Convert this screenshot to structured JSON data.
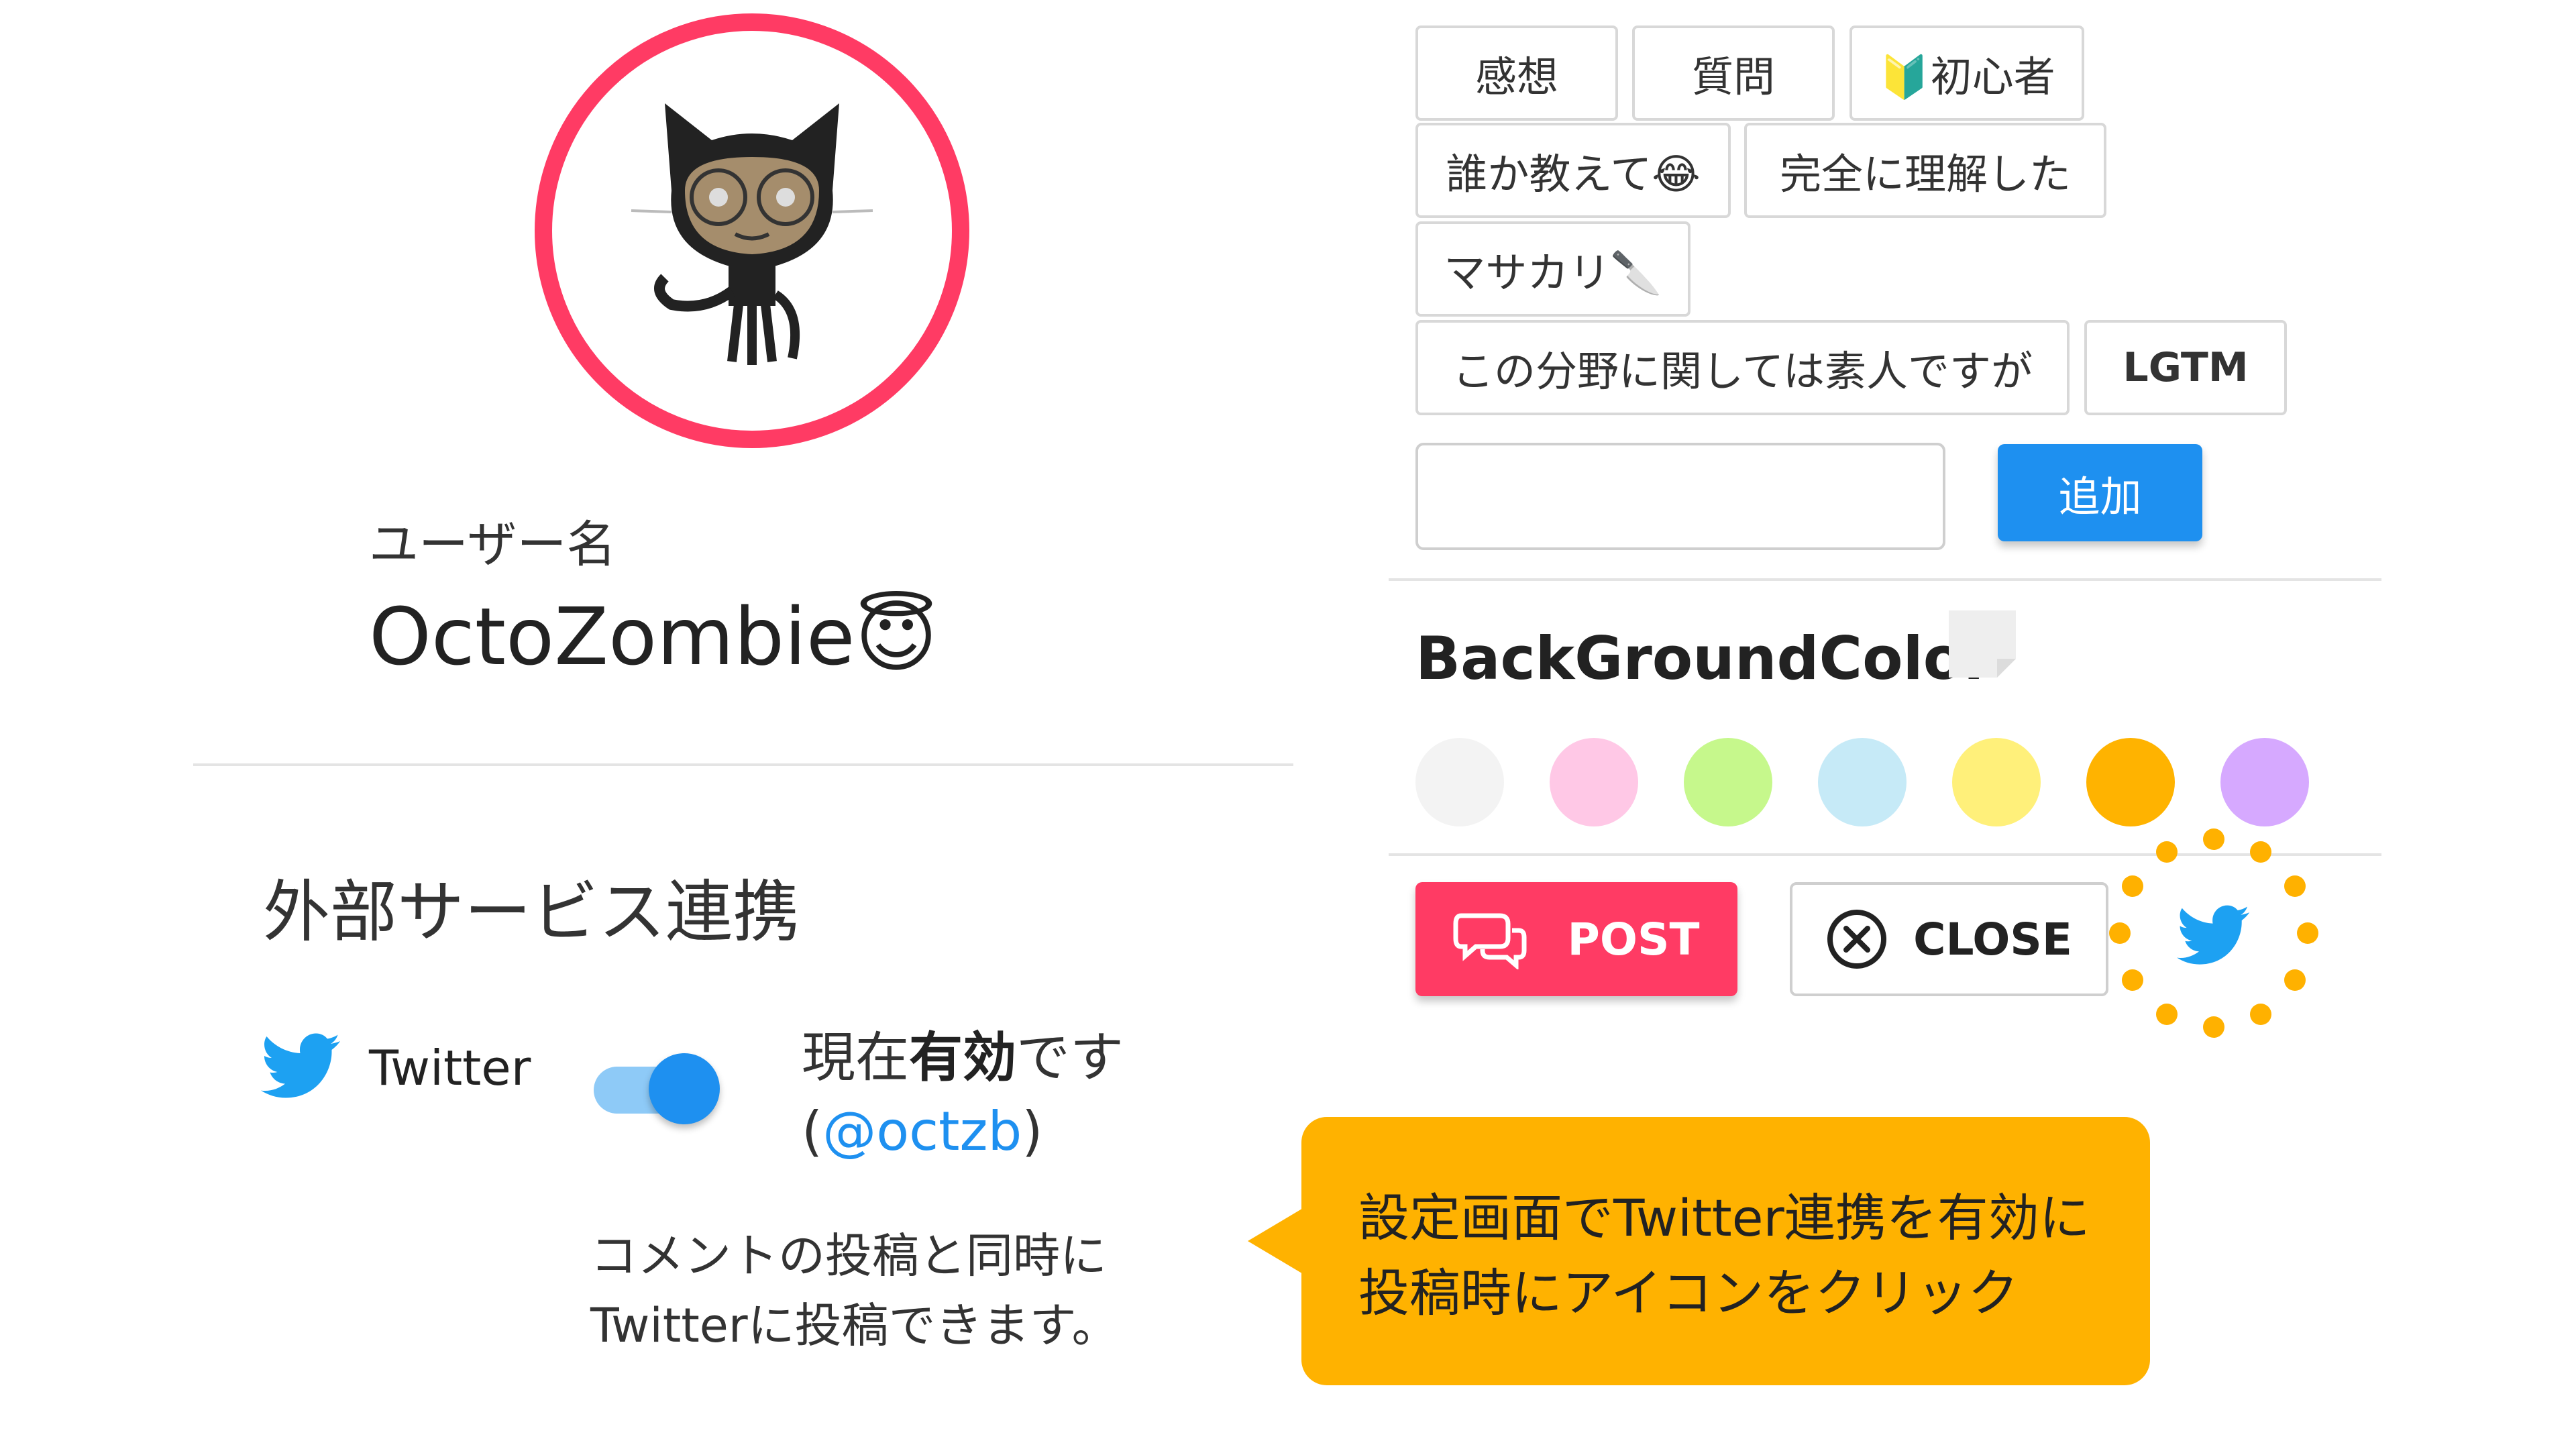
{
  "profile": {
    "username_label": "ユーザー名",
    "username": "OctoZombie😇"
  },
  "external": {
    "title": "外部サービス連携",
    "twitter_label": "Twitter",
    "status_prefix": "現在",
    "status_bold": "有効",
    "status_suffix": "です",
    "handle_open": "(",
    "handle": "@octzb",
    "handle_close": ")",
    "description_line1": "コメントの投稿と同時に",
    "description_line2": "Twitterに投稿できます。",
    "toggle_on": true
  },
  "tags": {
    "chips": [
      "感想",
      "質問",
      "🔰初心者",
      "誰か教えて😂",
      "完全に理解した",
      "マサカリ🔪",
      "この分野に関しては素人ですが",
      "LGTM"
    ],
    "input_value": "",
    "add_label": "追加"
  },
  "background": {
    "title": "BackGroundColor",
    "swatches": [
      "#f3f3f3",
      "#ffc8e6",
      "#c6f88c",
      "#c6eaf7",
      "#fff07a",
      "#ffb300",
      "#d6a9ff"
    ]
  },
  "actions": {
    "post_label": "POST",
    "close_label": "CLOSE"
  },
  "callout": {
    "line1": "設定画面でTwitter連携を有効に",
    "line2": "投稿時にアイコンをクリック"
  },
  "colors": {
    "accent_red": "#ff3b64",
    "accent_blue": "#1e90f0",
    "accent_orange": "#ffb200",
    "twitter_blue": "#1da1f2"
  },
  "icons": [
    "octocat-avatar",
    "twitter-icon",
    "note-icon",
    "chat-bubbles-icon",
    "close-circle-icon"
  ]
}
